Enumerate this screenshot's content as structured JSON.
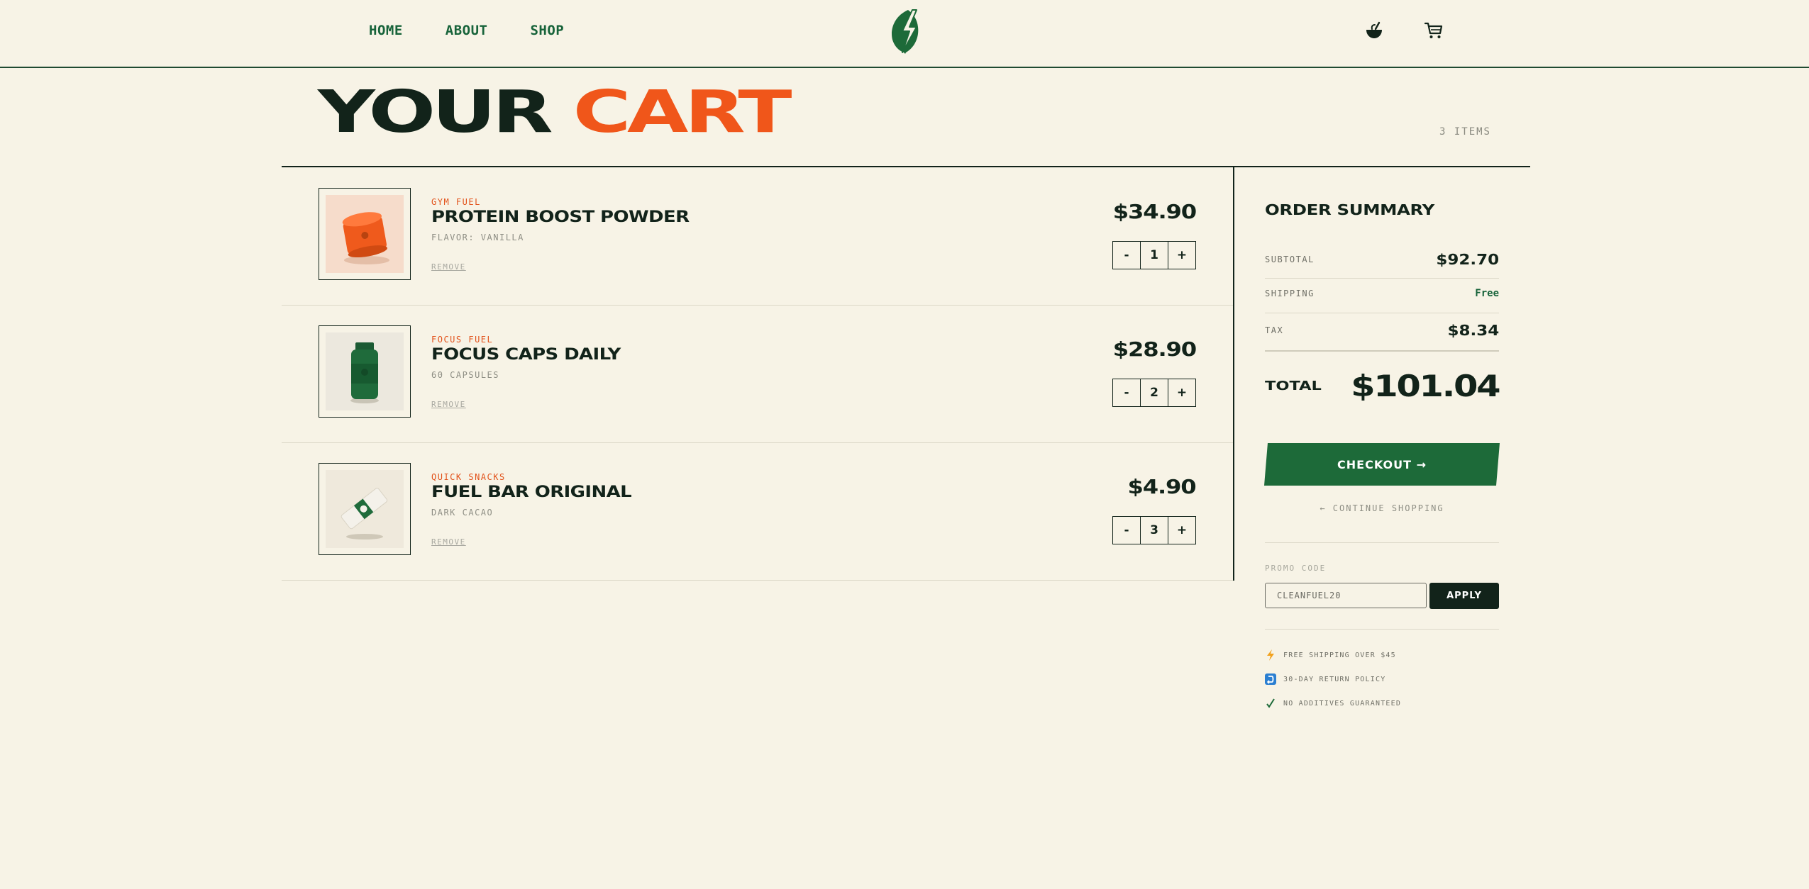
{
  "nav": {
    "home": "HOME",
    "about": "ABOUT",
    "shop": "SHOP"
  },
  "header": {
    "logo_icon": "leaf-bolt-logo-icon",
    "account_icon": "bowl-icon",
    "cart_icon": "cart-icon"
  },
  "page": {
    "title_part1": "YOUR",
    "title_part2": "CART",
    "items_count": "3 ITEMS"
  },
  "cart": {
    "items": [
      {
        "category": "GYM FUEL",
        "name": "PROTEIN BOOST POWDER",
        "variant": "FLAVOR: VANILLA",
        "remove": "REMOVE",
        "price": "$34.90",
        "minus": "-",
        "qty": "1",
        "plus": "+",
        "image_icon": "orange-tub-icon"
      },
      {
        "category": "FOCUS FUEL",
        "name": "FOCUS CAPS DAILY",
        "variant": "60 CAPSULES",
        "remove": "REMOVE",
        "price": "$28.90",
        "minus": "-",
        "qty": "2",
        "plus": "+",
        "image_icon": "green-bottle-icon"
      },
      {
        "category": "QUICK SNACKS",
        "name": "FUEL BAR ORIGINAL",
        "variant": "DARK CACAO",
        "remove": "REMOVE",
        "price": "$4.90",
        "minus": "-",
        "qty": "3",
        "plus": "+",
        "image_icon": "snack-bar-icon"
      }
    ]
  },
  "summary": {
    "title": "ORDER SUMMARY",
    "subtotal_label": "SUBTOTAL",
    "subtotal": "$92.70",
    "shipping_label": "SHIPPING",
    "shipping": "Free",
    "tax_label": "TAX",
    "tax": "$8.34",
    "total_label": "TOTAL",
    "total": "$101.04",
    "checkout": "CHECKOUT →",
    "continue": "← CONTINUE SHOPPING",
    "promo_label": "PROMO CODE",
    "promo_value": "CLEANFUEL20",
    "apply": "APPLY"
  },
  "perks": [
    {
      "icon": "lightning-icon",
      "text": "FREE SHIPPING OVER $45"
    },
    {
      "icon": "return-icon",
      "text": "30-DAY RETURN POLICY"
    },
    {
      "icon": "check-icon",
      "text": "NO ADDITIVES GUARANTEED"
    }
  ],
  "colors": {
    "background": "#f7f3e6",
    "brand_green": "#1d6a39",
    "accent_orange": "#f0561a",
    "ink": "#12231a"
  }
}
